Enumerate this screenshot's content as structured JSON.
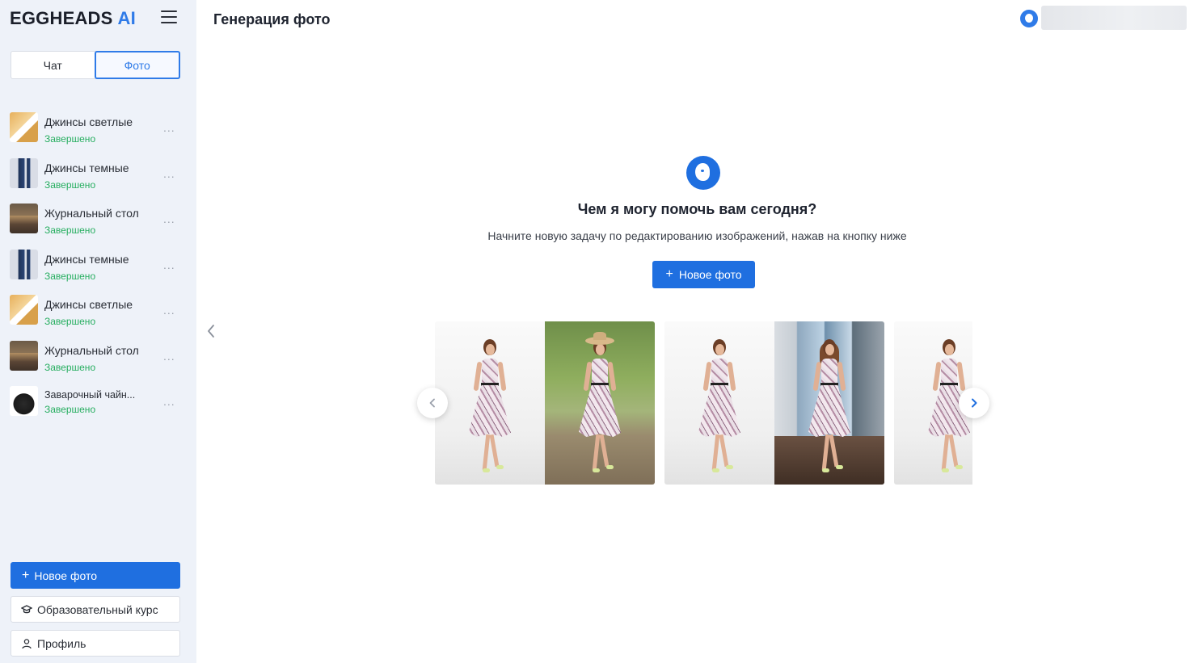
{
  "brand": {
    "name": "EGGHEADS",
    "suffix": "AI"
  },
  "sidebar": {
    "mode_tabs": [
      {
        "label": "Чат",
        "active": false
      },
      {
        "label": "Фото",
        "active": true
      }
    ],
    "history": [
      {
        "title": "Джинсы светлые",
        "status": "Завершено",
        "thumb": "jeans-light"
      },
      {
        "title": "Джинсы темные",
        "status": "Завершено",
        "thumb": "jeans-dark"
      },
      {
        "title": "Журнальный стол",
        "status": "Завершено",
        "thumb": "table"
      },
      {
        "title": "Джинсы темные",
        "status": "Завершено",
        "thumb": "jeans-dark"
      },
      {
        "title": "Джинсы светлые",
        "status": "Завершено",
        "thumb": "jeans-light"
      },
      {
        "title": "Журнальный стол",
        "status": "Завершено",
        "thumb": "table"
      },
      {
        "title": "Заварочный чайн...",
        "status": "Завершено",
        "thumb": "teapot"
      }
    ],
    "more_label": "...",
    "new_photo_label": "Новое фото",
    "course_label": "Образовательный курс",
    "profile_label": "Профиль"
  },
  "header": {
    "title": "Генерация фото"
  },
  "main": {
    "heading": "Чем я могу помочь вам сегодня?",
    "subheading": "Начните новую задачу по редактированию изображений, нажав на кнопку ниже",
    "new_photo_label": "Новое фото"
  },
  "colors": {
    "accent": "#1f6fe0",
    "status_done": "#27ae60",
    "sidebar_bg": "#eef2f9"
  },
  "icons": {
    "menu": "hamburger-icon",
    "more": "more-dots-icon",
    "course": "graduation-cap-icon",
    "profile": "user-icon",
    "collapse": "chevron-left-icon",
    "prev": "chevron-left-icon",
    "next": "chevron-right-icon"
  }
}
